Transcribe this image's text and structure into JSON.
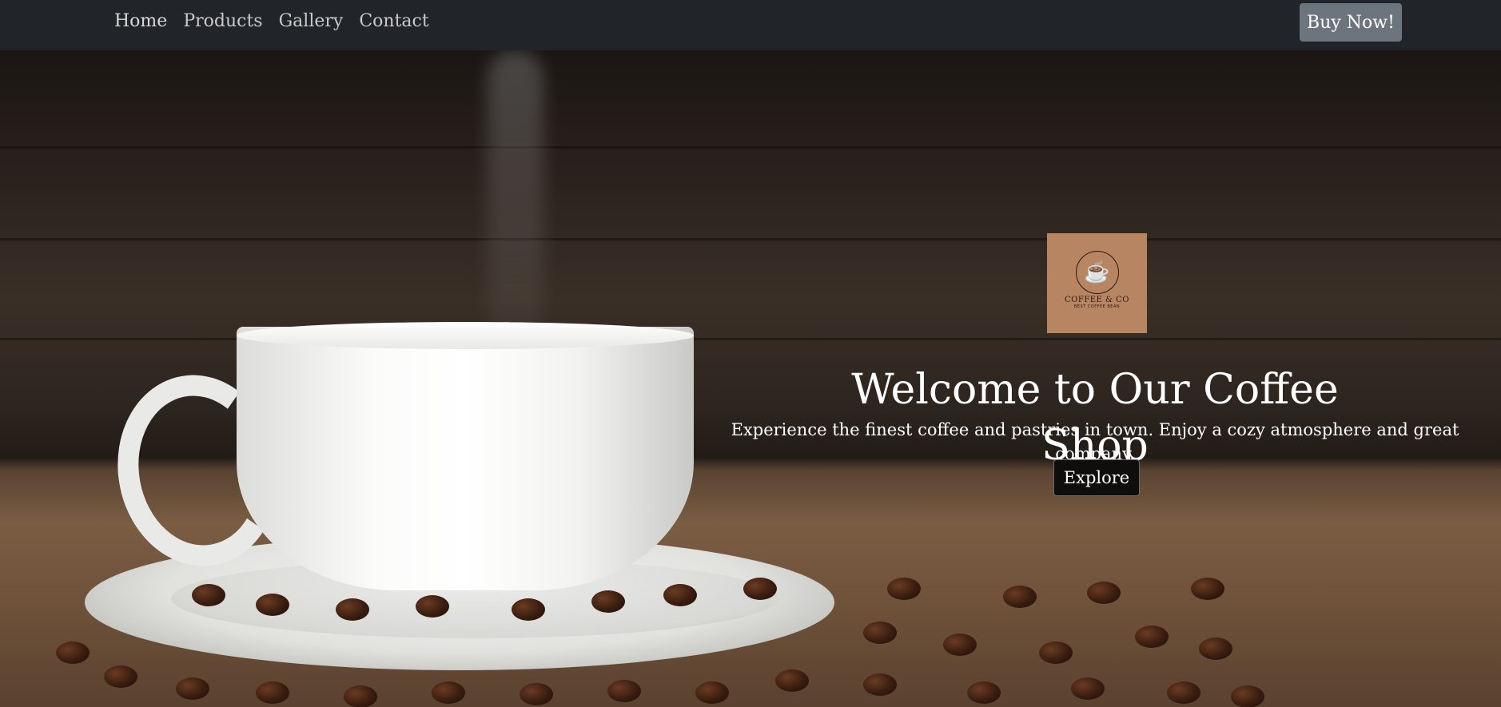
{
  "nav": {
    "links": [
      {
        "label": "Home"
      },
      {
        "label": "Products"
      },
      {
        "label": "Gallery"
      },
      {
        "label": "Contact"
      }
    ],
    "cta_label": "Buy Now!"
  },
  "hero": {
    "logo": {
      "name": "COFFEE & CO",
      "tagline": "BEST COFFEE BEAN"
    },
    "title": "Welcome to Our Coffee Shop",
    "subtitle": "Experience the finest coffee and pastries in town. Enjoy a cozy atmosphere and great company.",
    "button_label": "Explore"
  },
  "colors": {
    "navbar": "#212529",
    "cta": "#6c757d",
    "logo_bg": "#b88563"
  }
}
